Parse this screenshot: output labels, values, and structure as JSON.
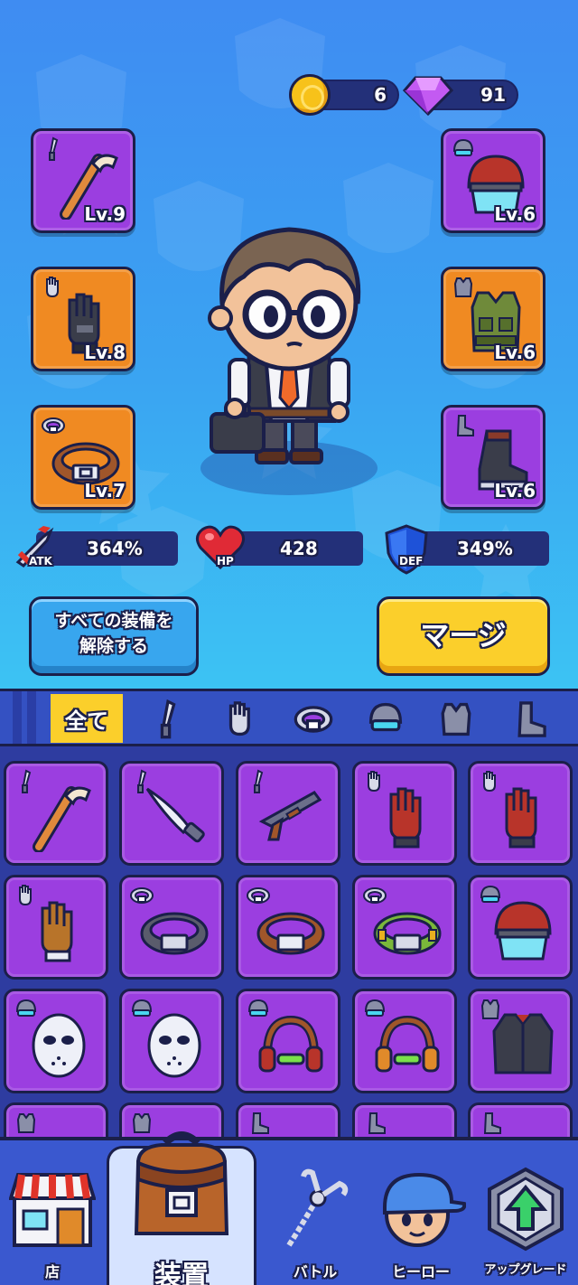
{
  "currency": {
    "coins": "6",
    "gems": "91"
  },
  "equipment_slots": {
    "weapon": {
      "level": "Lv.9",
      "icon": "hockey-stick-icon"
    },
    "gloves": {
      "level": "Lv.8",
      "icon": "black-glove-icon"
    },
    "belt": {
      "level": "Lv.7",
      "icon": "brown-belt-icon"
    },
    "helmet": {
      "level": "Lv.6",
      "icon": "red-helmet-icon"
    },
    "armor": {
      "level": "Lv.6",
      "icon": "green-vest-icon"
    },
    "boots": {
      "level": "Lv.6",
      "icon": "black-boot-icon"
    }
  },
  "stats": {
    "atk": {
      "label": "ATK",
      "value": "364%"
    },
    "hp": {
      "label": "HP",
      "value": "428"
    },
    "def": {
      "label": "DEF",
      "value": "349%"
    }
  },
  "buttons": {
    "unequip_line1": "すべての装備を",
    "unequip_line2": "解除する",
    "merge": "マージ"
  },
  "filter_tabs": {
    "all": "全て"
  },
  "nav": {
    "shop": "店",
    "equipment": "装置",
    "battle": "バトル",
    "hero": "ヒーロー",
    "upgrade": "アップグレード"
  },
  "colors": {
    "rarity_purple": "#9b3ee0",
    "rarity_orange": "#f08a22",
    "accent_yellow": "#fbcf2b",
    "panel_blue": "#2e3ca0"
  }
}
